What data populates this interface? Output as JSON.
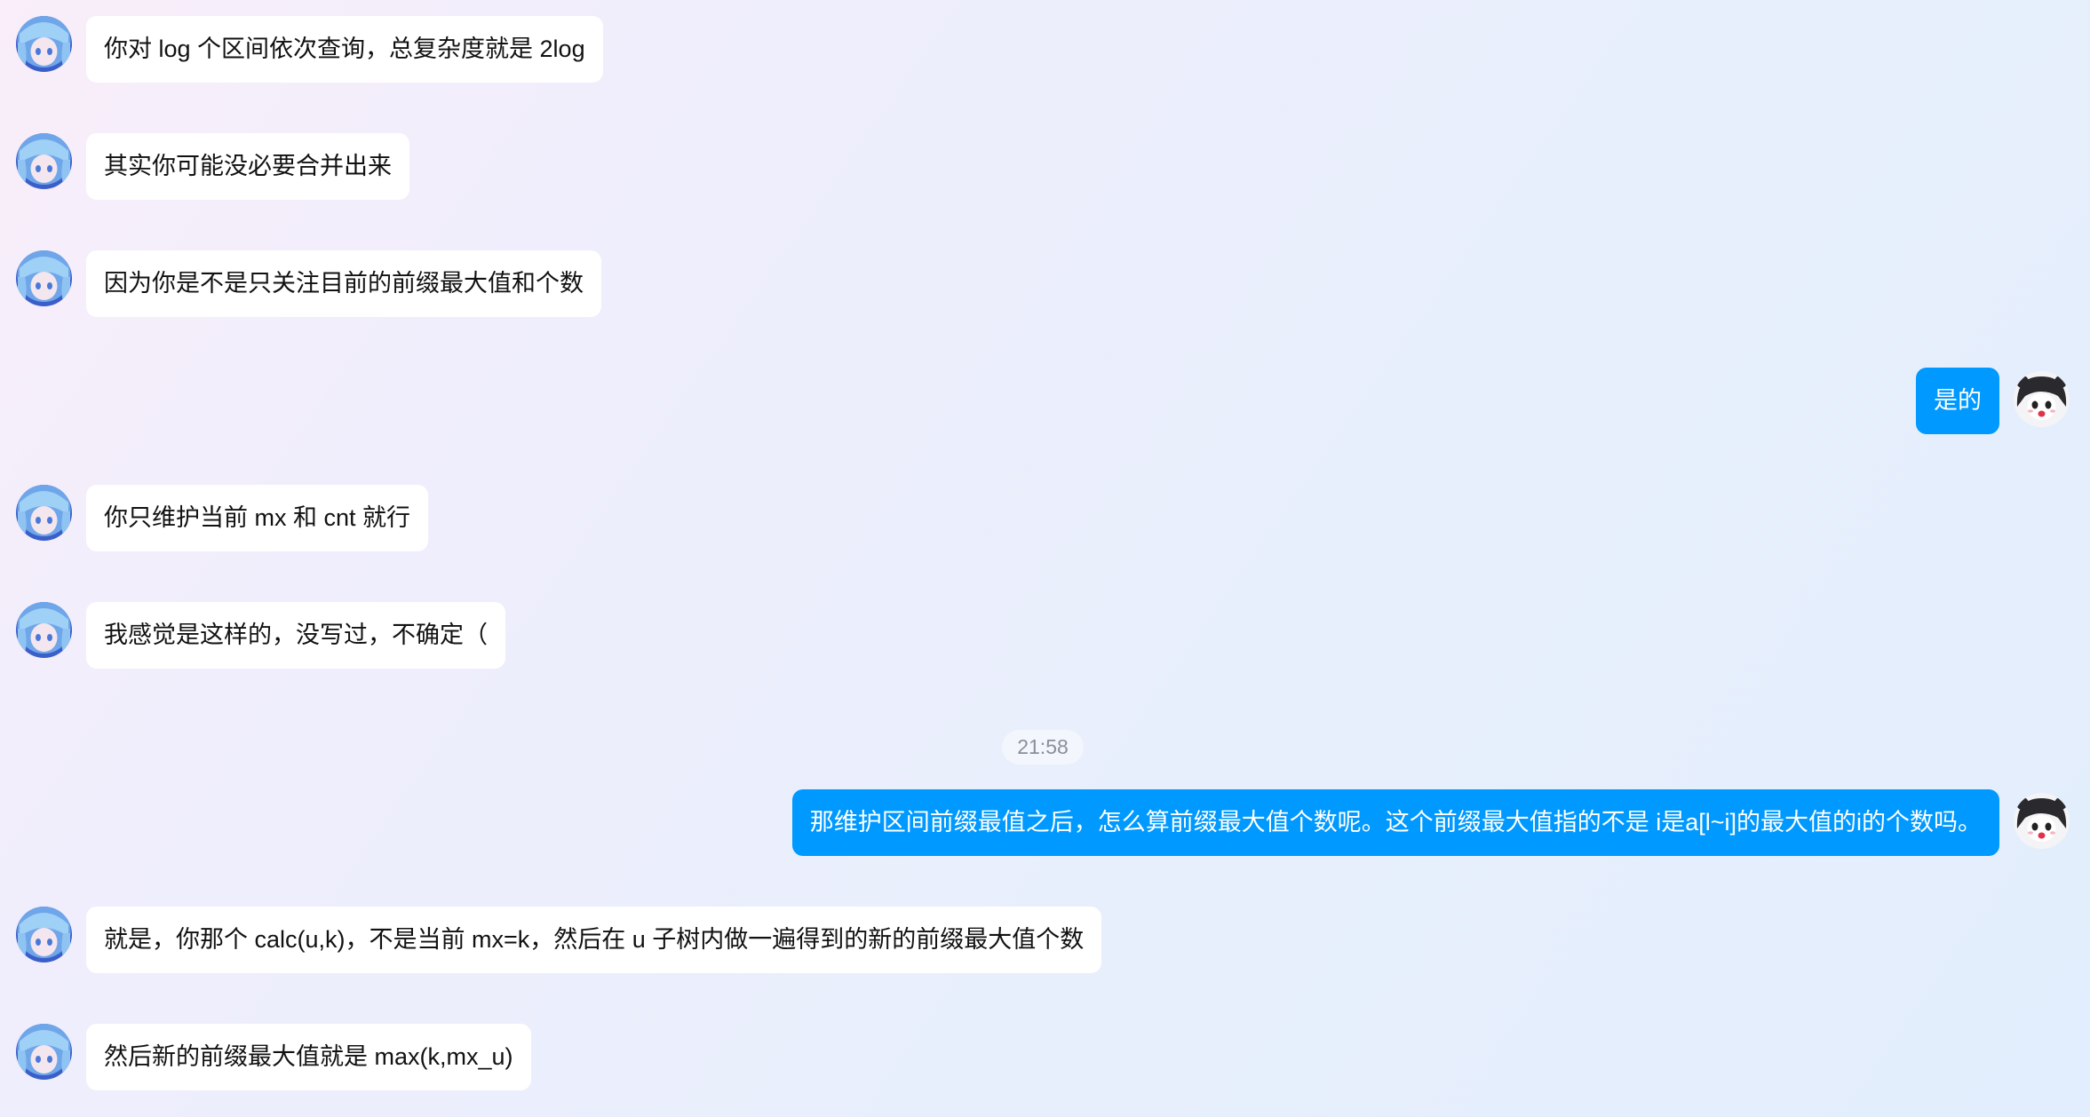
{
  "conversation": {
    "messages": [
      {
        "side": "incoming",
        "text": "你对 log 个区间依次查询，总复杂度就是 2log"
      },
      {
        "side": "incoming",
        "text": "其实你可能没必要合并出来"
      },
      {
        "side": "incoming",
        "text": "因为你是不是只关注目前的前缀最大值和个数"
      },
      {
        "side": "outgoing",
        "text": "是的"
      },
      {
        "side": "incoming",
        "text": "你只维护当前 mx 和 cnt 就行"
      },
      {
        "side": "incoming",
        "text": "我感觉是这样的，没写过，不确定（"
      },
      {
        "side": "outgoing",
        "text": "那维护区间前缀最值之后，怎么算前缀最大值个数呢。这个前缀最大值指的不是 i是a[l~i]的最大值的i的个数吗。"
      },
      {
        "side": "incoming",
        "text": "就是，你那个 calc(u,k)，不是当前 mx=k，然后在 u 子树内做一遍得到的新的前缀最大值个数"
      },
      {
        "side": "incoming",
        "text": "然后新的前缀最大值就是 max(k,mx_u)"
      }
    ],
    "timestamp": "21:58"
  },
  "colors": {
    "outgoing_bubble": "#0099ff",
    "incoming_bubble": "#ffffff",
    "timestamp_text": "#8a8f99"
  }
}
